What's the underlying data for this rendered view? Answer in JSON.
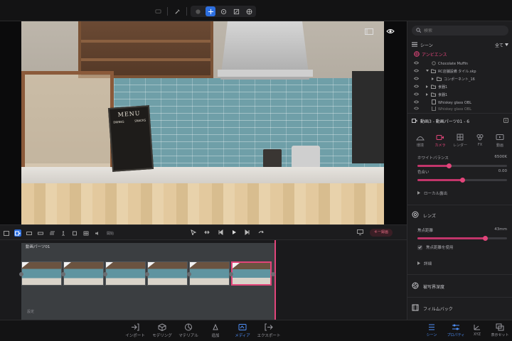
{
  "viewport": {
    "scene_menu": {
      "title": "MENU",
      "col1": "DRINKS",
      "col2": "SNACKS"
    }
  },
  "timeline_toolbar": {
    "label": "開始",
    "key_button": "キー録画"
  },
  "timeline": {
    "track_name": "動画パーツ01",
    "track_duration": "",
    "footer": "設定",
    "clip_count": 6,
    "selected_clip": 6
  },
  "bottombar": {
    "items": [
      {
        "label": "インポート",
        "icon": "import-icon"
      },
      {
        "label": "モデリング",
        "icon": "cube-icon"
      },
      {
        "label": "マテリアル",
        "icon": "material-icon"
      },
      {
        "label": "追加",
        "icon": "add-icon"
      },
      {
        "label": "メディア",
        "icon": "media-icon",
        "active": true
      },
      {
        "label": "エクスポート",
        "icon": "export-icon"
      }
    ]
  },
  "panel": {
    "search_placeholder": "検索",
    "scene_label": "シーン",
    "scene_filter": "全て",
    "tree": [
      {
        "label": "アンビエンス",
        "kind": "ambient"
      },
      {
        "label": "Chocolate Muffin"
      },
      {
        "label": "RC店舗設備 タイル.skp"
      },
      {
        "label": "コンポーネント_16"
      },
      {
        "label": "食器1"
      },
      {
        "label": "食器1"
      },
      {
        "label": "Whiskey glass OBL"
      },
      {
        "label": "Whiskey glass OBL"
      }
    ],
    "clip_title": "動画3 - 動画パーツ01 - 6",
    "tabs": [
      {
        "label": "環境",
        "icon": "environment-icon"
      },
      {
        "label": "カメラ",
        "icon": "camera-icon",
        "active": true
      },
      {
        "label": "レンダー",
        "icon": "render-icon"
      },
      {
        "label": "FX",
        "icon": "fx-icon"
      },
      {
        "label": "動画",
        "icon": "video-icon"
      }
    ],
    "white_balance": {
      "label": "ホワイトバランス",
      "value": "6500K",
      "fraction": 0.35
    },
    "tint": {
      "label": "色合い",
      "value": "0.00",
      "fraction": 0.5
    },
    "local_exposure": "ローカル露出",
    "lens_section": "レンズ",
    "focal_length": {
      "label": "焦点距離",
      "value": "43mm",
      "fraction": 0.75
    },
    "auto_focal": "焦点距離を使用",
    "details": "詳細",
    "depth_of_field": "被写界深度",
    "film_back": "フィルムバック"
  },
  "rightbar": {
    "items": [
      {
        "label": "シーン",
        "icon": "scene-icon",
        "active": true
      },
      {
        "label": "プロパティ",
        "icon": "properties-icon",
        "active": true
      },
      {
        "label": "XYZ",
        "icon": "xyz-icon"
      },
      {
        "label": "表示セット",
        "icon": "display-set-icon"
      }
    ]
  }
}
